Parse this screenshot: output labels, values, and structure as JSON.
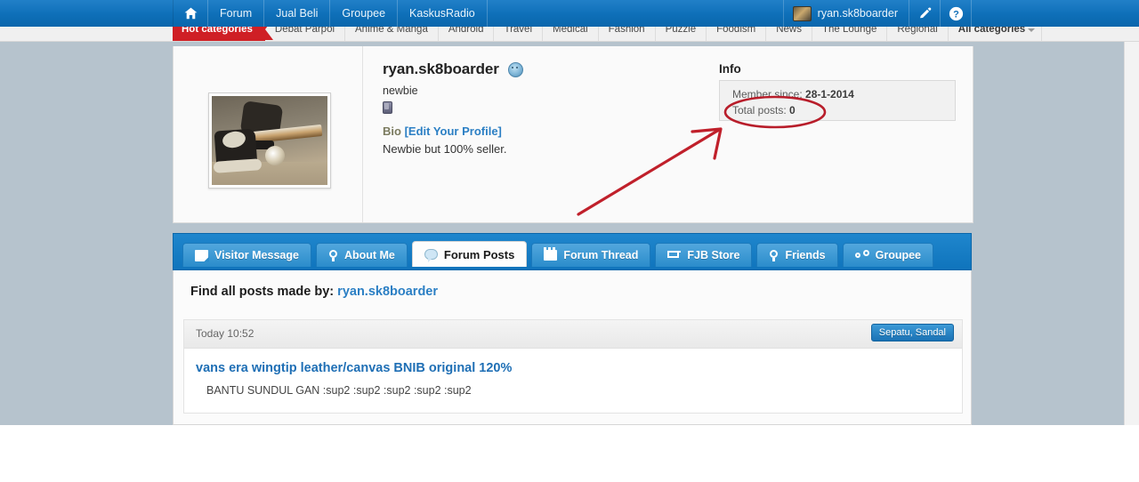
{
  "topnav": {
    "home_icon": "home-icon",
    "items": [
      {
        "label": "Forum"
      },
      {
        "label": "Jual Beli"
      },
      {
        "label": "Groupee"
      },
      {
        "label": "KaskusRadio"
      }
    ],
    "username": "ryan.sk8boarder",
    "avatar_icon": "user-avatar-thumbnail",
    "edit_icon": "pencil-icon",
    "help_icon": "question-mark-icon"
  },
  "catbar": {
    "hot_label": "Hot categories",
    "items": [
      {
        "label": "Debat Parpol"
      },
      {
        "label": "Anime & Manga"
      },
      {
        "label": "Android"
      },
      {
        "label": "Travel"
      },
      {
        "label": "Medical"
      },
      {
        "label": "Fashion"
      },
      {
        "label": "Puzzle"
      },
      {
        "label": "Foodism"
      },
      {
        "label": "News"
      },
      {
        "label": "The Lounge"
      },
      {
        "label": "Regional"
      }
    ],
    "all_label": "All categories"
  },
  "profile": {
    "avatar_alt": "skateboard-photo-avatar",
    "username": "ryan.sk8boarder",
    "badge_icon": "smiley-badge-icon",
    "rank": "newbie",
    "device_icon": "mobile-device-icon",
    "bio_label": "Bio",
    "bio_edit_label": "[Edit Your Profile]",
    "bio_text": "Newbie but 100% seller.",
    "info_title": "Info",
    "info_member_since_label": "Member since:",
    "info_member_since_value": "28-1-2014",
    "info_total_posts_label": "Total posts:",
    "info_total_posts_value": "0"
  },
  "tabs": [
    {
      "label": "Visitor Message",
      "icon": "message-icon",
      "active": false
    },
    {
      "label": "About Me",
      "icon": "person-icon",
      "active": false
    },
    {
      "label": "Forum Posts",
      "icon": "speech-bubble-icon",
      "active": true
    },
    {
      "label": "Forum Thread",
      "icon": "calendar-icon",
      "active": false
    },
    {
      "label": "FJB Store",
      "icon": "shopping-cart-icon",
      "active": false
    },
    {
      "label": "Friends",
      "icon": "person-icon",
      "active": false
    },
    {
      "label": "Groupee",
      "icon": "group-people-icon",
      "active": false
    }
  ],
  "posts": {
    "find_all_label": "Find all posts made by:",
    "find_all_user": "ryan.sk8boarder",
    "items": [
      {
        "time": "Today 10:52",
        "category": "Sepatu, Sandal",
        "title": "vans era wingtip leather/canvas BNIB original 120%",
        "snippet": "BANTU SUNDUL GAN :sup2 :sup2 :sup2 :sup2 :sup2"
      }
    ]
  },
  "annotations": {
    "ellipse_target": "Total posts: 0",
    "arrow_color": "#c0202b",
    "ellipse_color": "#b81d2a"
  }
}
